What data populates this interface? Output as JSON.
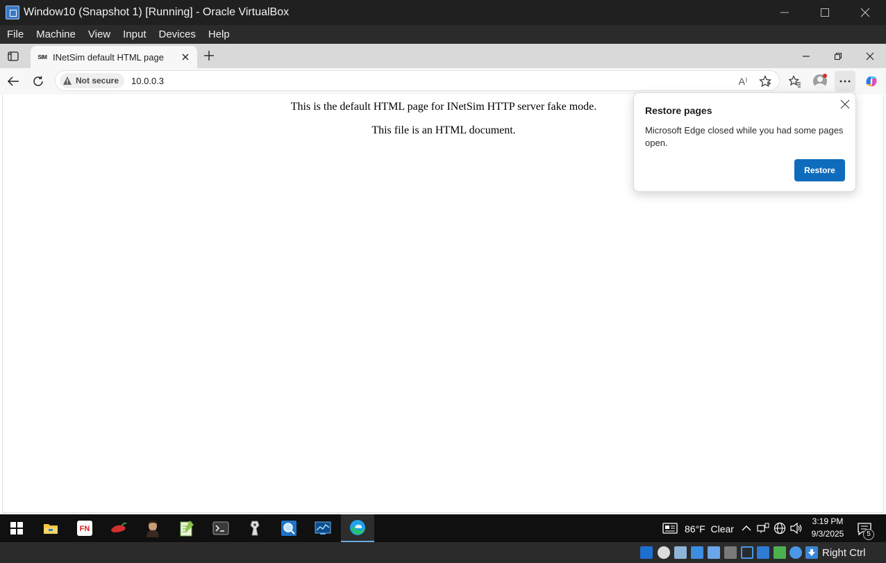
{
  "host_window": {
    "title": "Window10 (Snapshot 1) [Running] - Oracle VirtualBox",
    "menu": [
      "File",
      "Machine",
      "View",
      "Input",
      "Devices",
      "Help"
    ]
  },
  "browser": {
    "tab": {
      "favicon_text": "SIM",
      "title": "INetSim default HTML page"
    },
    "address": {
      "security_label": "Not secure",
      "url": "10.0.0.3"
    },
    "read_aloud_glyph": "A⁾"
  },
  "page": {
    "paragraphs": [
      "This is the default HTML page for INetSim HTTP server fake mode.",
      "This file is an HTML document."
    ]
  },
  "restore_popup": {
    "title": "Restore pages",
    "message": "Microsoft Edge closed while you had some pages open.",
    "button_label": "Restore"
  },
  "taskbar": {
    "weather": {
      "temperature": "86°F",
      "condition": "Clear"
    },
    "clock": {
      "time": "3:19 PM",
      "date": "9/3/2025"
    },
    "notification_count": "5",
    "apps": [
      "start",
      "file-explorer",
      "fakenet",
      "pepper",
      "portrait",
      "notepad-plus",
      "terminal",
      "system-informer",
      "process-explorer",
      "resource-monitor",
      "edge"
    ]
  },
  "host_statusbar": {
    "host_key_label": "Right Ctrl"
  },
  "colors": {
    "accent": "#0f6cbd",
    "taskbar": "#101010",
    "host_chrome": "#202020"
  }
}
